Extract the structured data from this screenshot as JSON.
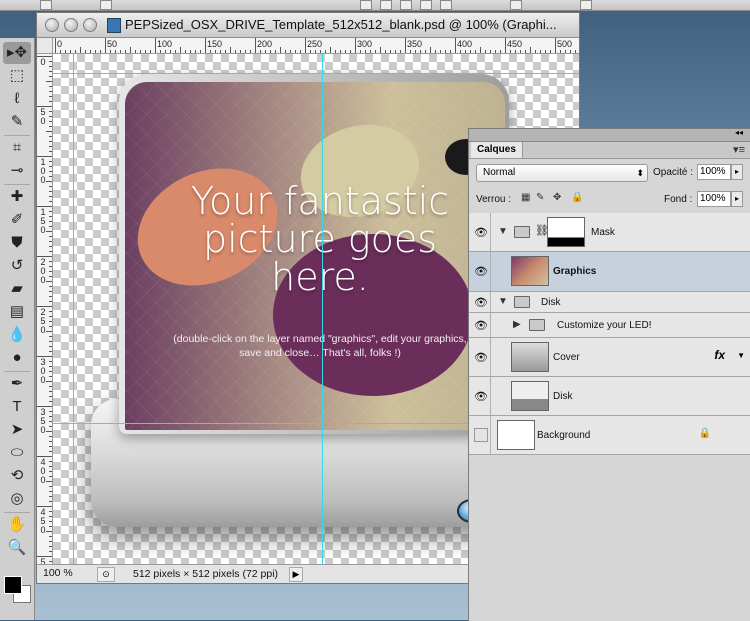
{
  "document": {
    "title": "PEPSized_OSX_DRIVE_Template_512x512_blank.psd @ 100% (Graphi...",
    "ruler_top": [
      "0",
      "50",
      "100",
      "150",
      "200",
      "250",
      "300",
      "350",
      "400",
      "450",
      "500"
    ],
    "ruler_left": [
      "0",
      "5\n0",
      "1\n0\n0",
      "1\n5\n0",
      "2\n0\n0",
      "2\n5\n0",
      "3\n0\n0",
      "3\n5\n0",
      "4\n0\n0",
      "4\n5\n0",
      "5\n0\n0"
    ],
    "status": {
      "zoom": "100 %",
      "info": "512 pixels × 512 pixels (72 ppi)",
      "arrow": "▶"
    }
  },
  "artwork": {
    "headline": "Your fantastic picture goes here.",
    "subline": "(double-click on the layer named \"graphics\", edit your graphics, save and close… That's all, folks !)"
  },
  "tools": [
    {
      "name": "move-tool",
      "glyph": "▸✥"
    },
    {
      "name": "marquee-tool",
      "glyph": "⬚"
    },
    {
      "name": "lasso-tool",
      "glyph": "ℓ"
    },
    {
      "name": "quick-selection-tool",
      "glyph": "✎"
    },
    {
      "name": "crop-tool",
      "glyph": "⌗"
    },
    {
      "name": "eyedropper-tool",
      "glyph": "⊸"
    },
    {
      "name": "healing-tool",
      "glyph": "✚"
    },
    {
      "name": "brush-tool",
      "glyph": "✐"
    },
    {
      "name": "stamp-tool",
      "glyph": "⛊"
    },
    {
      "name": "history-brush-tool",
      "glyph": "↺"
    },
    {
      "name": "eraser-tool",
      "glyph": "▰"
    },
    {
      "name": "gradient-tool",
      "glyph": "▤"
    },
    {
      "name": "blur-tool",
      "glyph": "💧"
    },
    {
      "name": "dodge-tool",
      "glyph": "●"
    },
    {
      "name": "pen-tool",
      "glyph": "✒"
    },
    {
      "name": "type-tool",
      "glyph": "T"
    },
    {
      "name": "path-selection-tool",
      "glyph": "➤"
    },
    {
      "name": "shape-tool",
      "glyph": "⬭"
    },
    {
      "name": "3d-rotate-tool",
      "glyph": "⟲"
    },
    {
      "name": "3d-orbit-tool",
      "glyph": "◎"
    },
    {
      "name": "hand-tool",
      "glyph": "✋"
    },
    {
      "name": "zoom-tool",
      "glyph": "🔍"
    }
  ],
  "layers_panel": {
    "tab": "Calques",
    "menu": "▾≡",
    "blend_mode": "Normal",
    "opacity_label": "Opacité :",
    "opacity_value": "100%",
    "lock_label": "Verrou :",
    "fill_label": "Fond :",
    "fill_value": "100%",
    "layers": [
      {
        "name": "Mask",
        "type": "group-masked",
        "visible": true,
        "expanded": true
      },
      {
        "name": "Graphics",
        "type": "smart-object",
        "visible": true,
        "selected": true
      },
      {
        "name": "Disk",
        "type": "group",
        "visible": true,
        "expanded": true
      },
      {
        "name": "Customize your LED!",
        "type": "group",
        "visible": true,
        "expanded": false
      },
      {
        "name": "Cover",
        "type": "layer",
        "visible": true,
        "fx": "fx"
      },
      {
        "name": "Disk",
        "type": "layer",
        "visible": true
      },
      {
        "name": "Background",
        "type": "background",
        "visible": false,
        "locked": true
      }
    ]
  },
  "colors": {
    "guide": "#34d9e6",
    "selected_layer": "#c7d1dd",
    "foreground": "#000000",
    "background": "#ffffff"
  }
}
